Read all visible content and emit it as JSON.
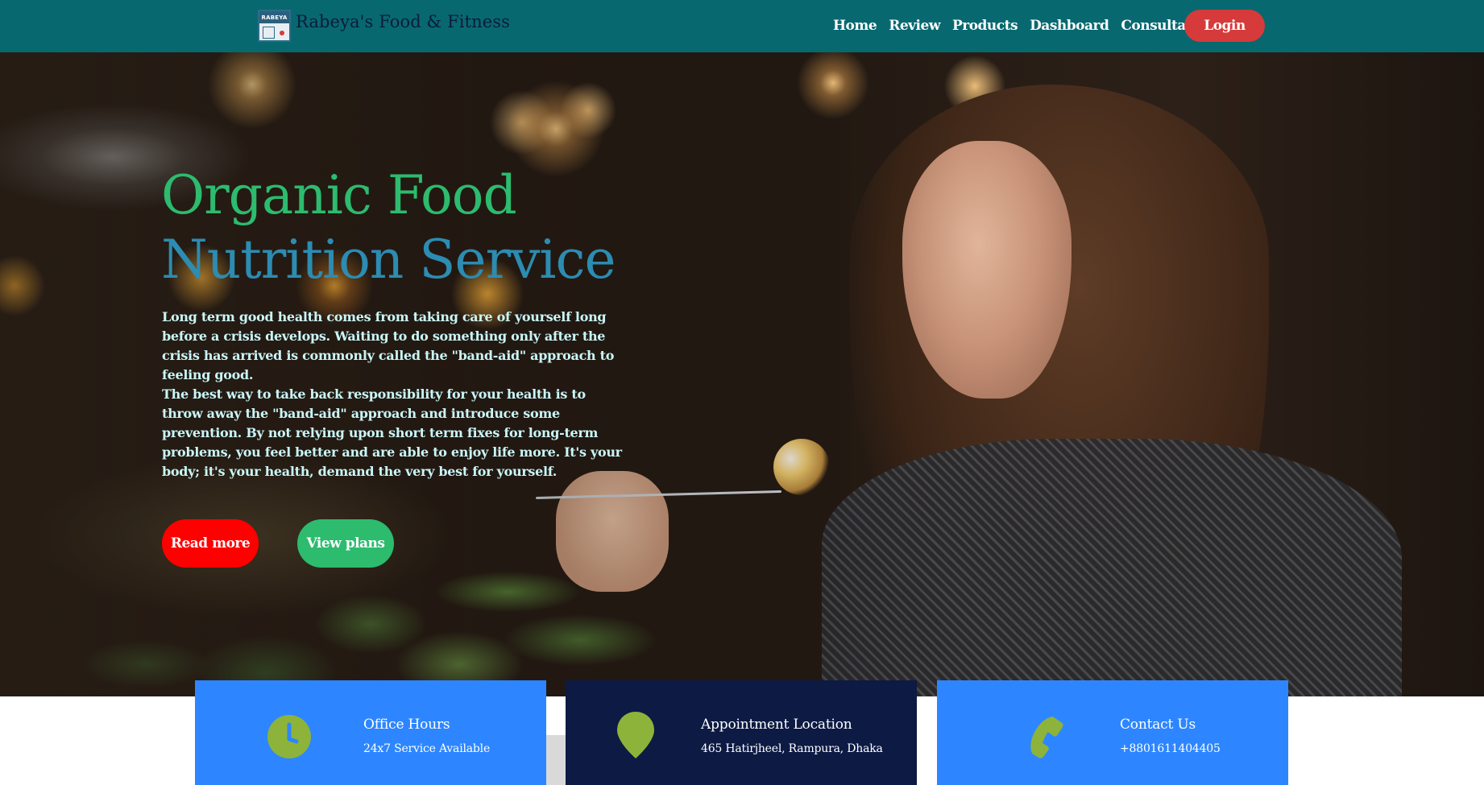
{
  "brand": {
    "logo_text": "RABEYA",
    "name": "Rabeya's Food & Fitness"
  },
  "nav": {
    "links": [
      "Home",
      "Review",
      "Products",
      "Dashboard",
      "Consultation"
    ],
    "login_label": "Login"
  },
  "hero": {
    "title_line1": "Organic Food",
    "title_line2": "Nutrition Service",
    "paragraph1": "Long term good health comes from taking care of yourself long before a crisis develops. Waiting to do something only after the crisis has arrived is commonly called the \"band-aid\" approach to feeling good.",
    "paragraph2": "The best way to take back responsibility for your health is to throw away the \"band-aid\" approach and introduce some prevention. By not relying upon short term fixes for long-term problems, you feel better and are able to enjoy life more. It's your body; it's your health, demand the very best for yourself.",
    "read_more_label": "Read more",
    "view_plans_label": "View plans"
  },
  "cards": [
    {
      "icon": "clock-icon",
      "title": "Office Hours",
      "subtitle": "24x7 Service Available"
    },
    {
      "icon": "location-pin-icon",
      "title": "Appointment Location",
      "subtitle": "465 Hatirjheel, Rampura, Dhaka"
    },
    {
      "icon": "phone-icon",
      "title": "Contact Us",
      "subtitle": "+8801611404405"
    }
  ],
  "colors": {
    "navbar": "#086870",
    "login": "#d63a3a",
    "title_green": "#2dbb6e",
    "title_blue": "#2c8cb1",
    "read_more": "#ff0000",
    "view_plans": "#2dbb6e",
    "card_blue": "#2d86ff",
    "card_navy": "#0d1a44",
    "icon_green": "#8db33a"
  }
}
